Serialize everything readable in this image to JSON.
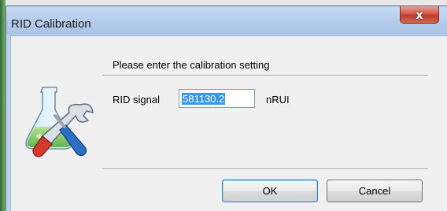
{
  "window": {
    "title": "RID Calibration",
    "close_label": "x"
  },
  "dialog": {
    "prompt": "Please enter the calibration setting",
    "field_label": "RID signal",
    "field_value": "581130.2",
    "unit": "nRUI",
    "ok_label": "OK",
    "cancel_label": "Cancel",
    "icon": "flask-tools-icon"
  },
  "colors": {
    "titlebar": "#b3cbe9",
    "close_button": "#c03a2b",
    "selection": "#3399ff",
    "client_background": "#f0f0f0"
  }
}
